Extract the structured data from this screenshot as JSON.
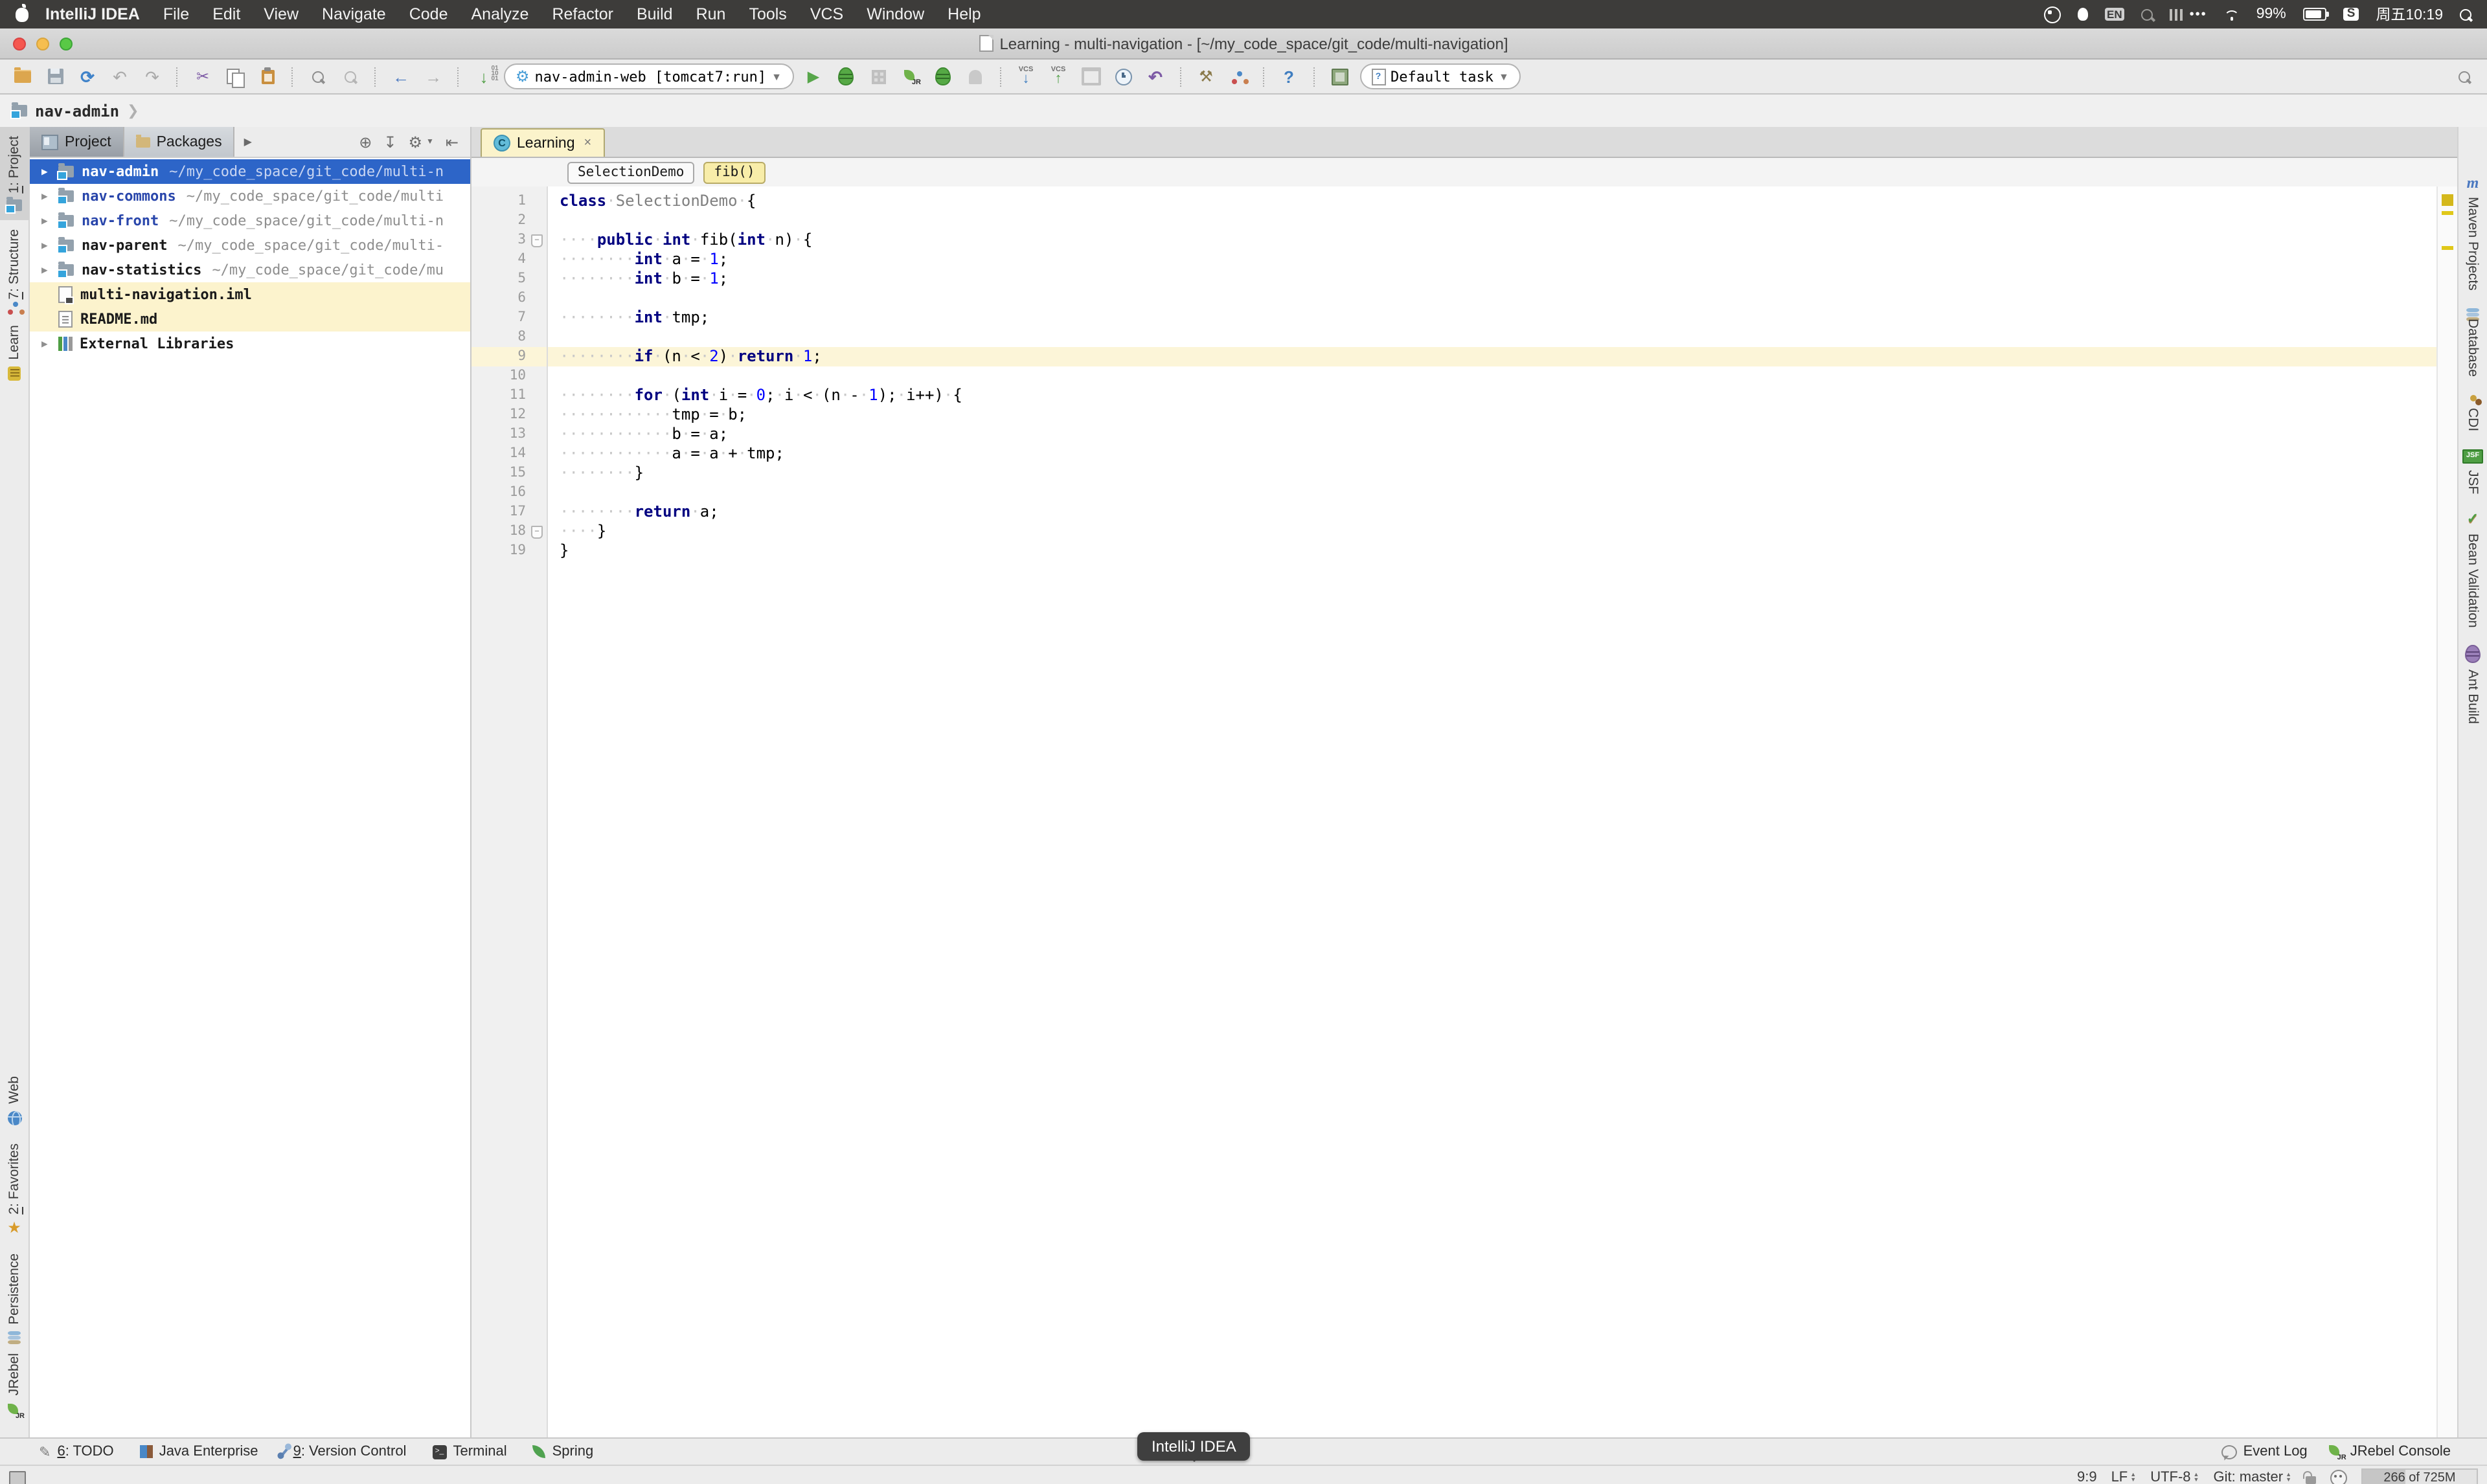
{
  "macos": {
    "menus": [
      "IntelliJ IDEA",
      "File",
      "Edit",
      "View",
      "Navigate",
      "Code",
      "Analyze",
      "Refactor",
      "Build",
      "Run",
      "Tools",
      "VCS",
      "Window",
      "Help"
    ],
    "status": {
      "input_badge": "EN",
      "app_badge": "S",
      "battery": "99%",
      "clock": "周五10:19",
      "dots": "•••"
    }
  },
  "window": {
    "title": "Learning - multi-navigation - [~/my_code_space/git_code/multi-navigation]"
  },
  "toolbar": {
    "run_config": "nav-admin-web [tomcat7:run]",
    "default_task": "Default task",
    "compile_digits": "01 10 01",
    "vcs_label": "VCS"
  },
  "navbar": {
    "crumb": "nav-admin"
  },
  "left_stripe": {
    "top": [
      {
        "num": "1",
        "rest": ": Project",
        "icon": "mfolder",
        "active": true
      },
      {
        "num": "7",
        "rest": ": Structure",
        "icon": "struct",
        "active": false
      },
      {
        "num": "",
        "rest": "Learn",
        "icon": "medal",
        "active": false
      }
    ],
    "bottom": [
      {
        "num": "",
        "rest": "Web",
        "icon": "globe",
        "active": false
      },
      {
        "num": "2",
        "rest": ": Favorites",
        "icon": "star",
        "active": false
      },
      {
        "num": "",
        "rest": "Persistence",
        "icon": "db",
        "active": false
      },
      {
        "num": "",
        "rest": "JRebel",
        "icon": "rocket",
        "active": false
      }
    ]
  },
  "right_stripe": [
    {
      "label": "Maven Projects",
      "icon": "maven"
    },
    {
      "label": "Database",
      "icon": "db"
    },
    {
      "label": "CDI",
      "icon": "cdi"
    },
    {
      "label": "JSF",
      "icon": "jsf"
    },
    {
      "label": "Bean Validation",
      "icon": "bean"
    },
    {
      "label": "Ant Build",
      "icon": "ant"
    }
  ],
  "project_panel": {
    "tabs": [
      {
        "label": "Project",
        "active": true
      },
      {
        "label": "Packages",
        "active": false
      }
    ],
    "tree": [
      {
        "arrow": true,
        "icon": "mfolder",
        "name": "nav-admin",
        "path": "~/my_code_space/git_code/multi-n",
        "state": "sel"
      },
      {
        "arrow": true,
        "icon": "mfolder",
        "name": "nav-commons",
        "path": "~/my_code_space/git_code/multi",
        "state": "mod"
      },
      {
        "arrow": true,
        "icon": "mfolder",
        "name": "nav-front",
        "path": "~/my_code_space/git_code/multi-n",
        "state": "mod"
      },
      {
        "arrow": true,
        "icon": "mfolder",
        "name": "nav-parent",
        "path": "~/my_code_space/git_code/multi-",
        "state": ""
      },
      {
        "arrow": true,
        "icon": "mfolder",
        "name": "nav-statistics",
        "path": "~/my_code_space/git_code/mu",
        "state": ""
      },
      {
        "arrow": false,
        "icon": "iml",
        "name": "multi-navigation.iml",
        "path": "",
        "state": "hl"
      },
      {
        "arrow": false,
        "icon": "md",
        "name": "README.md",
        "path": "",
        "state": "hl"
      },
      {
        "arrow": true,
        "icon": "libs",
        "name": "External Libraries",
        "path": "",
        "state": ""
      }
    ]
  },
  "editor": {
    "tab": "Learning",
    "tab_icon": "C",
    "close": "×",
    "breadcrumbs": [
      "SelectionDemo",
      "fib()"
    ],
    "lines": [
      {
        "n": 1,
        "t": [
          [
            "k",
            "class"
          ],
          [
            "s",
            "·"
          ],
          [
            "g",
            "SelectionDemo"
          ],
          [
            "s",
            "·"
          ],
          [
            "p",
            "{"
          ]
        ]
      },
      {
        "n": 2,
        "t": []
      },
      {
        "n": 3,
        "fold": true,
        "t": [
          [
            "s",
            "····"
          ],
          [
            "k",
            "public"
          ],
          [
            "s",
            "·"
          ],
          [
            "k",
            "int"
          ],
          [
            "s",
            "·"
          ],
          [
            "p",
            "fib("
          ],
          [
            "k",
            "int"
          ],
          [
            "s",
            "·"
          ],
          [
            "p",
            "n)"
          ],
          [
            "s",
            "·"
          ],
          [
            "p",
            "{"
          ]
        ]
      },
      {
        "n": 4,
        "t": [
          [
            "s",
            "········"
          ],
          [
            "k",
            "int"
          ],
          [
            "s",
            "·"
          ],
          [
            "p",
            "a"
          ],
          [
            "s",
            "·"
          ],
          [
            "p",
            "="
          ],
          [
            "s",
            "·"
          ],
          [
            "d",
            "1"
          ],
          [
            "p",
            ";"
          ]
        ]
      },
      {
        "n": 5,
        "t": [
          [
            "s",
            "········"
          ],
          [
            "k",
            "int"
          ],
          [
            "s",
            "·"
          ],
          [
            "p",
            "b"
          ],
          [
            "s",
            "·"
          ],
          [
            "p",
            "="
          ],
          [
            "s",
            "·"
          ],
          [
            "d",
            "1"
          ],
          [
            "p",
            ";"
          ]
        ]
      },
      {
        "n": 6,
        "t": []
      },
      {
        "n": 7,
        "t": [
          [
            "s",
            "········"
          ],
          [
            "k",
            "int"
          ],
          [
            "s",
            "·"
          ],
          [
            "p",
            "tmp;"
          ]
        ]
      },
      {
        "n": 8,
        "t": []
      },
      {
        "n": 9,
        "hl": true,
        "t": [
          [
            "s",
            "········"
          ],
          [
            "k",
            "if"
          ],
          [
            "s",
            "·"
          ],
          [
            "p",
            "(n"
          ],
          [
            "s",
            "·"
          ],
          [
            "p",
            "<"
          ],
          [
            "s",
            "·"
          ],
          [
            "d",
            "2"
          ],
          [
            "p",
            ")"
          ],
          [
            "s",
            "·"
          ],
          [
            "k",
            "return"
          ],
          [
            "s",
            "·"
          ],
          [
            "d",
            "1"
          ],
          [
            "p",
            ";"
          ]
        ]
      },
      {
        "n": 10,
        "t": []
      },
      {
        "n": 11,
        "t": [
          [
            "s",
            "········"
          ],
          [
            "k",
            "for"
          ],
          [
            "s",
            "·"
          ],
          [
            "p",
            "("
          ],
          [
            "k",
            "int"
          ],
          [
            "s",
            "·"
          ],
          [
            "p",
            "i"
          ],
          [
            "s",
            "·"
          ],
          [
            "p",
            "="
          ],
          [
            "s",
            "·"
          ],
          [
            "d",
            "0"
          ],
          [
            "p",
            ";"
          ],
          [
            "s",
            "·"
          ],
          [
            "p",
            "i"
          ],
          [
            "s",
            "·"
          ],
          [
            "p",
            "<"
          ],
          [
            "s",
            "·"
          ],
          [
            "p",
            "(n"
          ],
          [
            "s",
            "·"
          ],
          [
            "p",
            "-"
          ],
          [
            "s",
            "·"
          ],
          [
            "d",
            "1"
          ],
          [
            "p",
            ");"
          ],
          [
            "s",
            "·"
          ],
          [
            "p",
            "i++)"
          ],
          [
            "s",
            "·"
          ],
          [
            "p",
            "{"
          ]
        ]
      },
      {
        "n": 12,
        "t": [
          [
            "s",
            "············"
          ],
          [
            "p",
            "tmp"
          ],
          [
            "s",
            "·"
          ],
          [
            "p",
            "="
          ],
          [
            "s",
            "·"
          ],
          [
            "p",
            "b;"
          ]
        ]
      },
      {
        "n": 13,
        "t": [
          [
            "s",
            "············"
          ],
          [
            "p",
            "b"
          ],
          [
            "s",
            "·"
          ],
          [
            "p",
            "="
          ],
          [
            "s",
            "·"
          ],
          [
            "p",
            "a;"
          ]
        ]
      },
      {
        "n": 14,
        "t": [
          [
            "s",
            "············"
          ],
          [
            "p",
            "a"
          ],
          [
            "s",
            "·"
          ],
          [
            "p",
            "="
          ],
          [
            "s",
            "·"
          ],
          [
            "p",
            "a"
          ],
          [
            "s",
            "·"
          ],
          [
            "p",
            "+"
          ],
          [
            "s",
            "·"
          ],
          [
            "p",
            "tmp;"
          ]
        ]
      },
      {
        "n": 15,
        "t": [
          [
            "s",
            "········"
          ],
          [
            "p",
            "}"
          ]
        ]
      },
      {
        "n": 16,
        "t": []
      },
      {
        "n": 17,
        "t": [
          [
            "s",
            "········"
          ],
          [
            "k",
            "return"
          ],
          [
            "s",
            "·"
          ],
          [
            "p",
            "a;"
          ]
        ]
      },
      {
        "n": 18,
        "fold": true,
        "t": [
          [
            "s",
            "····"
          ],
          [
            "p",
            "}"
          ]
        ]
      },
      {
        "n": 19,
        "t": [
          [
            "p",
            "}"
          ]
        ]
      }
    ]
  },
  "bottom_bar": {
    "left": [
      {
        "num": "6",
        "rest": ": TODO",
        "icon": "todo"
      },
      {
        "num": "",
        "rest": "Java Enterprise",
        "icon": "jee"
      },
      {
        "num": "9",
        "rest": ": Version Control",
        "icon": "vc"
      },
      {
        "num": "",
        "rest": "Terminal",
        "icon": "term"
      },
      {
        "num": "",
        "rest": "Spring",
        "icon": "leaf"
      }
    ],
    "right": [
      {
        "label": "Event Log",
        "icon": "bubble"
      },
      {
        "label": "JRebel Console",
        "icon": "rocket"
      }
    ]
  },
  "status_bar": {
    "position": "9:9",
    "line_ending": "LF",
    "encoding": "UTF-8",
    "vcs": "Git: master",
    "memory": "266 of 725M"
  },
  "dock_tooltip": "IntelliJ IDEA"
}
